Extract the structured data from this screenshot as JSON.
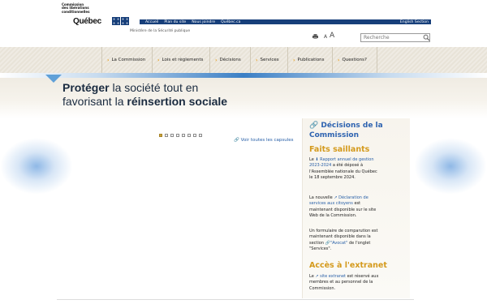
{
  "header": {
    "logo_lines": [
      "Commission",
      "des libérations",
      "conditionnelles"
    ],
    "logo_quebec": "Québec",
    "fleur_glyph": "⚜",
    "links": [
      "Accueil",
      "Plan du site",
      "Nous joindre",
      "Québec.ca"
    ],
    "english": "English Section",
    "ministry": "Ministère de la Sécurité publique",
    "font_small": "A",
    "font_big": "A",
    "search_placeholder": "Recherche"
  },
  "nav": {
    "items": [
      "La Commission",
      "Lois et règlements",
      "Décisions",
      "Services",
      "Publications",
      "Questions?"
    ]
  },
  "banner": {
    "line1_bold": "Protéger",
    "line1_rest": " la société tout en",
    "line2_rest": "favorisant la ",
    "line2_bold": "réinsertion sociale"
  },
  "carousel": {
    "slide_count": 8,
    "active_index": 0,
    "all_link": "Voir toutes les capsules"
  },
  "sidebar": {
    "title": "Décisions de la Commission",
    "faits_title": "Faits saillants",
    "p1_pre": "Le ",
    "p1_link": "Rapport annuel de gestion 2023-2024",
    "p1_post": " a été déposé à l'Assemblée nationale du Québec le 18 septembre 2024.",
    "p2_pre": "La nouvelle ",
    "p2_link": "Déclaration de services aux citoyens",
    "p2_post": " est maintenant disponible sur le site Web de la Commission.",
    "p3_pre": "Un formulaire de comparution est maintenant disponible dans la section ",
    "p3_link": "\"Avocat\"",
    "p3_post": " de l'onglet \"Services\".",
    "extranet_title": "Accès à l'extranet",
    "p4_pre": "Le ",
    "p4_link": "site extranet",
    "p4_post": " est réservé aux membres et au personnel de la Commission."
  },
  "colors": {
    "quebec_blue": "#173f7a",
    "link_blue": "#2960a8",
    "accent_gold": "#d49a1c"
  }
}
